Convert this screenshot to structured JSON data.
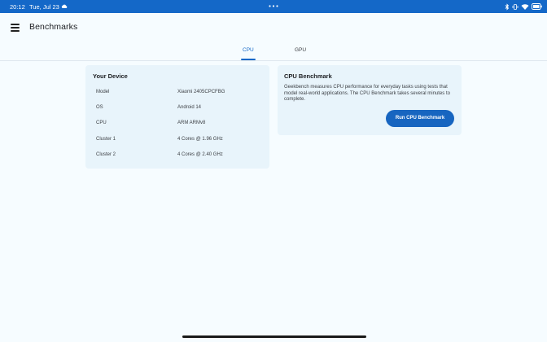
{
  "status_bar": {
    "time": "20:12",
    "date": "Tue, Jul 23",
    "icons": [
      "cloud-icon",
      "more-dots-icon",
      "bluetooth-icon",
      "vibrate-icon",
      "wifi-icon",
      "battery-icon"
    ]
  },
  "app_bar": {
    "title": "Benchmarks"
  },
  "tabs": [
    {
      "label": "CPU",
      "active": true
    },
    {
      "label": "GPU",
      "active": false
    }
  ],
  "device_card": {
    "title": "Your Device",
    "rows": [
      {
        "label": "Model",
        "value": "Xiaomi 2405CPCFBG"
      },
      {
        "label": "OS",
        "value": "Android 14"
      },
      {
        "label": "CPU",
        "value": "ARM ARMv8"
      },
      {
        "label": "Cluster 1",
        "value": "4 Cores @ 1.96 GHz"
      },
      {
        "label": "Cluster 2",
        "value": "4 Cores @ 2.40 GHz"
      }
    ]
  },
  "benchmark_card": {
    "title": "CPU Benchmark",
    "description": "Geekbench measures CPU performance for everyday tasks using tests that model real-world applications. The CPU Benchmark takes several minutes to complete.",
    "button_label": "Run CPU Benchmark"
  },
  "colors": {
    "accent": "#1468c8",
    "background": "#f6fcff",
    "card": "#e8f4fb"
  }
}
